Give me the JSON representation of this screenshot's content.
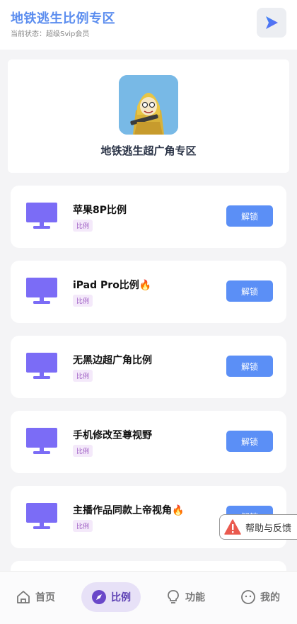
{
  "header": {
    "title": "地铁逃生比例专区",
    "status": "当前状态：超级Svip会员",
    "play_icon": "play-icon"
  },
  "hero": {
    "title": "地铁逃生超广角专区",
    "image": "game-character-avatar"
  },
  "items": [
    {
      "name": "苹果8P比例",
      "tag": "比例",
      "button": "解锁"
    },
    {
      "name": "iPad Pro比例🔥",
      "tag": "比例",
      "button": "解锁"
    },
    {
      "name": "无黑边超广角比例",
      "tag": "比例",
      "button": "解锁"
    },
    {
      "name": "手机修改至尊视野",
      "tag": "比例",
      "button": "解锁"
    },
    {
      "name": "主播作品同款上帝视角🔥",
      "tag": "比例",
      "button": "解锁"
    }
  ],
  "help": {
    "label": "帮助与反馈"
  },
  "tabs": [
    {
      "label": "首页",
      "icon": "home-icon"
    },
    {
      "label": "比例",
      "icon": "compass-icon",
      "active": true
    },
    {
      "label": "功能",
      "icon": "bulb-icon"
    },
    {
      "label": "我的",
      "icon": "face-icon"
    }
  ],
  "colors": {
    "accent": "#5b8ff6",
    "title": "#5b8def",
    "monitor": "#7b6cf6",
    "tab_active_bg": "#e7e1f7"
  }
}
